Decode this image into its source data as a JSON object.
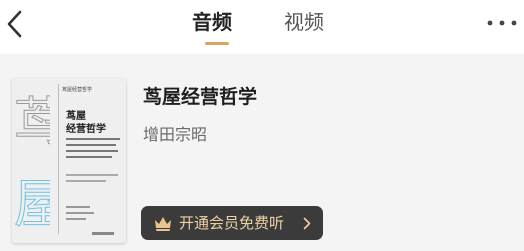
{
  "header": {
    "tabs": [
      {
        "label": "音频",
        "active": true
      },
      {
        "label": "视频",
        "active": false
      }
    ],
    "active_accent_color": "#d9a65a",
    "icons": {
      "back": "chevron-left-icon",
      "more": "more-horizontal-icon"
    }
  },
  "book": {
    "title": "茑屋经营哲学",
    "author": "增田宗昭",
    "cover": {
      "large_chars_top": "茑",
      "large_chars_bottom": "屋",
      "publisher_line": "茑屋经营哲学",
      "title_line_1": "茑屋",
      "title_line_2": "经营哲学"
    }
  },
  "vip_button": {
    "label": "开通会员免费听",
    "icon": "crown-icon",
    "chevron": "chevron-right-icon",
    "background": "#3c3b3b",
    "text_color": "#ecd2a0"
  }
}
